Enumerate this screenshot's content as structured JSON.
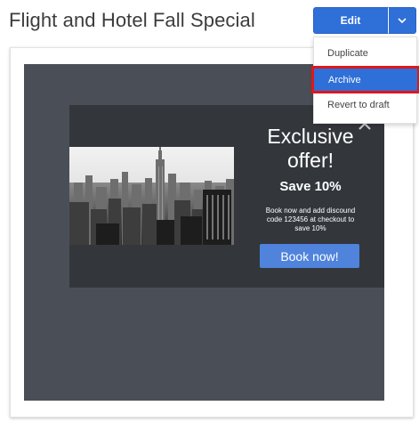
{
  "page": {
    "title": "Flight and Hotel Fall Special"
  },
  "toolbar": {
    "edit_label": "Edit"
  },
  "dropdown": {
    "items": [
      {
        "label": "Duplicate"
      },
      {
        "label": "Archive",
        "highlighted": true
      },
      {
        "label": "Revert to draft"
      }
    ]
  },
  "preview": {
    "headline_line1": "Exclusive",
    "headline_line2": "offer!",
    "save_text": "Save 10%",
    "body_line1": "Book now and add discound",
    "body_line2": "code 123456 at checkout to",
    "body_line3": "save 10%",
    "cta_label": "Book now!"
  },
  "colors": {
    "accent": "#2f6fd8",
    "highlight_border": "#e0161b",
    "popup_bg": "#33373c",
    "preview_bg": "#4a4f57"
  },
  "icons": [
    "chevron-down-icon",
    "close-icon"
  ]
}
